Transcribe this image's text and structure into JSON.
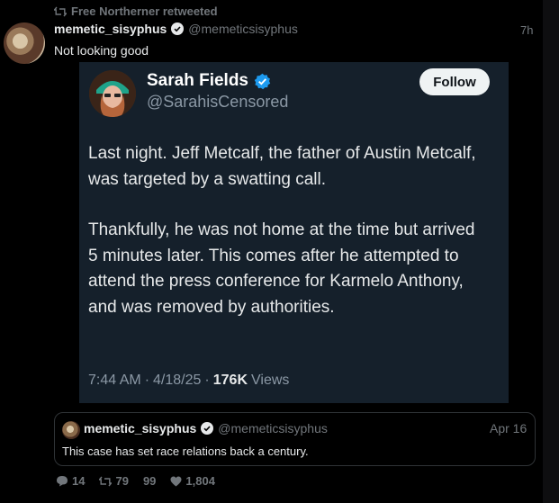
{
  "retweet": {
    "text": "Free Northerner retweeted"
  },
  "post": {
    "display_name": "memetic_sisyphus",
    "handle": "@memeticsisyphus",
    "time": "7h",
    "text": "Not looking good"
  },
  "embed": {
    "display_name": "Sarah Fields",
    "handle": "@SarahisCensored",
    "follow_label": "Follow",
    "paragraphs": [
      "Last night. Jeff Metcalf, the father of Austin Metcalf, was targeted by a swatting call.",
      "Thankfully, he was not home at the time but arrived 5 minutes later.  This comes after he attempted to attend the press conference for Karmelo Anthony, and was removed by authorities."
    ],
    "time": "7:44 AM",
    "date": "4/18/25",
    "views_count": "176K",
    "views_label": "Views"
  },
  "quote": {
    "display_name": "memetic_sisyphus",
    "handle": "@memeticsisyphus",
    "date": "Apr 16",
    "text": "This case has set race relations back a century."
  },
  "actions": {
    "replies": "14",
    "retweets": "79",
    "quote_glyph": "99",
    "likes": "1,804"
  },
  "colors": {
    "background": "#000000",
    "embed_background": "#15202b",
    "verified": "#1d9bf0",
    "muted": "#71767b"
  }
}
